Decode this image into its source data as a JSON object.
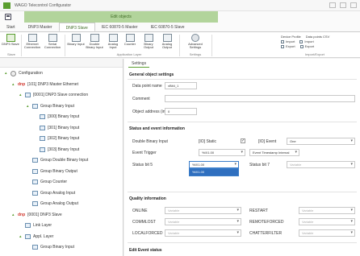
{
  "app": {
    "title": "WAGO Telecontrol Configurator",
    "context_label": "Edit objects"
  },
  "tabs": [
    {
      "label": "Start",
      "active": false
    },
    {
      "label": "DNP3 Master",
      "active": false
    },
    {
      "label": "DNP3 Slave",
      "active": true
    },
    {
      "label": "IEC 60870-5 Master",
      "active": false
    },
    {
      "label": "IEC 60870-5 Slave",
      "active": false
    }
  ],
  "ribbon": {
    "buttons": [
      {
        "label": "DNP3 Slave",
        "icon": "dnp3-slave-icon"
      },
      {
        "label": "Ethernet Connection",
        "icon": "ethernet-icon"
      },
      {
        "label": "Serial Connection",
        "icon": "serial-icon"
      },
      {
        "label": "Binary Input",
        "icon": "binary-input-icon"
      },
      {
        "label": "Double Binary Input",
        "icon": "double-binary-icon"
      },
      {
        "label": "Analog Input",
        "icon": "analog-input-icon"
      },
      {
        "label": "Counter",
        "icon": "counter-icon"
      },
      {
        "label": "Binary Output",
        "icon": "binary-output-icon"
      },
      {
        "label": "Analog Output",
        "icon": "analog-output-icon"
      },
      {
        "label": "Advanced Settings",
        "icon": "gear-icon"
      }
    ],
    "groups": [
      "Slave",
      "Application Layer",
      "Settings",
      "Import/Export"
    ],
    "device_profile": "Device Profile",
    "data_points_csv": "Data points CSV",
    "import": "Import",
    "export": "Export"
  },
  "tree": {
    "rows": [
      {
        "label": "Configuration",
        "level": 0,
        "icon": "gear-icon",
        "caret": "▴",
        "dnp": ""
      },
      {
        "label": "[101] DNP3 Master Ethernet",
        "level": 1,
        "icon": "dnp-icon",
        "caret": "▴",
        "dnp": "dnp"
      },
      {
        "label": "[0001] DNP3 Slave connection",
        "level": 2,
        "icon": "connection-icon",
        "caret": "▴",
        "dnp": ""
      },
      {
        "label": "Group Binary Input",
        "level": 3,
        "icon": "folder-icon",
        "caret": "▴",
        "dnp": ""
      },
      {
        "label": "[300] Binary Input",
        "level": 4,
        "icon": "point-icon",
        "caret": "",
        "dnp": ""
      },
      {
        "label": "[301] Binary Input",
        "level": 4,
        "icon": "point-icon",
        "caret": "",
        "dnp": ""
      },
      {
        "label": "[302] Binary Input",
        "level": 4,
        "icon": "point-icon",
        "caret": "",
        "dnp": ""
      },
      {
        "label": "[303] Binary Input",
        "level": 4,
        "icon": "point-icon",
        "caret": "",
        "dnp": ""
      },
      {
        "label": "Group Double Binary Input",
        "level": 3,
        "icon": "folder-icon",
        "caret": "",
        "dnp": ""
      },
      {
        "label": "Group Binary Output",
        "level": 3,
        "icon": "folder-icon",
        "caret": "",
        "dnp": ""
      },
      {
        "label": "Group Counter",
        "level": 3,
        "icon": "folder-icon",
        "caret": "",
        "dnp": ""
      },
      {
        "label": "Group Analog Input",
        "level": 3,
        "icon": "folder-icon",
        "caret": "",
        "dnp": ""
      },
      {
        "label": "Group Analog Output",
        "level": 3,
        "icon": "folder-icon",
        "caret": "",
        "dnp": ""
      },
      {
        "label": "[0001] DNP3 Slave",
        "level": 1,
        "icon": "dnp-icon",
        "caret": "▴",
        "dnp": "dnp"
      },
      {
        "label": "Link Layer",
        "level": 2,
        "icon": "layer-icon",
        "caret": "",
        "dnp": ""
      },
      {
        "label": "Appl. Layer",
        "level": 2,
        "icon": "layer-icon",
        "caret": "▴",
        "dnp": ""
      },
      {
        "label": "Group Binary Input",
        "level": 3,
        "icon": "folder-icon",
        "caret": "",
        "dnp": ""
      }
    ]
  },
  "settings": {
    "tab": "Settings",
    "general": {
      "title": "General object settings",
      "data_point_name_label": "Data point name",
      "data_point_name_value": "xBit4_1",
      "comment_label": "Comment",
      "comment_value": "",
      "object_address_label": "Object address (index)",
      "object_address_value": "0"
    },
    "status": {
      "title": "Status and event information",
      "double_binary_label": "Double Binary Input",
      "double_binary_value": "[IO] Static",
      "event_label": "[IO] Event",
      "event_value": "One",
      "event_trigger_label": "Event Trigger",
      "event_trigger_value": "%IX1.00",
      "event_timestamp_value": "Event Timestamp Internal",
      "status_bit5_label": "Status bit 5",
      "status_bit5_value": "%IX1.00",
      "status_bit7_label": "Status bit 7",
      "status_bit7_value": "Variable",
      "dropdown_option": "%IX1.00"
    },
    "quality": {
      "title": "Quality information",
      "online_label": "ONLINE",
      "online_value": "Variable",
      "restart_label": "RESTART",
      "restart_value": "Variable",
      "commlost_label": "COMMLOST",
      "commlost_value": "Variable",
      "remoteforced_label": "REMOTEFORCED",
      "remoteforced_value": "Variable",
      "localforced_label": "LOCALFORCED",
      "localforced_value": "Variable",
      "chatterfilter_label": "CHATTERFILTER",
      "chatterfilter_value": "Variable"
    },
    "footer_title": "Edit Event status"
  },
  "colors": {
    "brand_green": "#5a9e2f",
    "context_band": "#b2d49b",
    "selection_blue": "#2f6fbf"
  }
}
